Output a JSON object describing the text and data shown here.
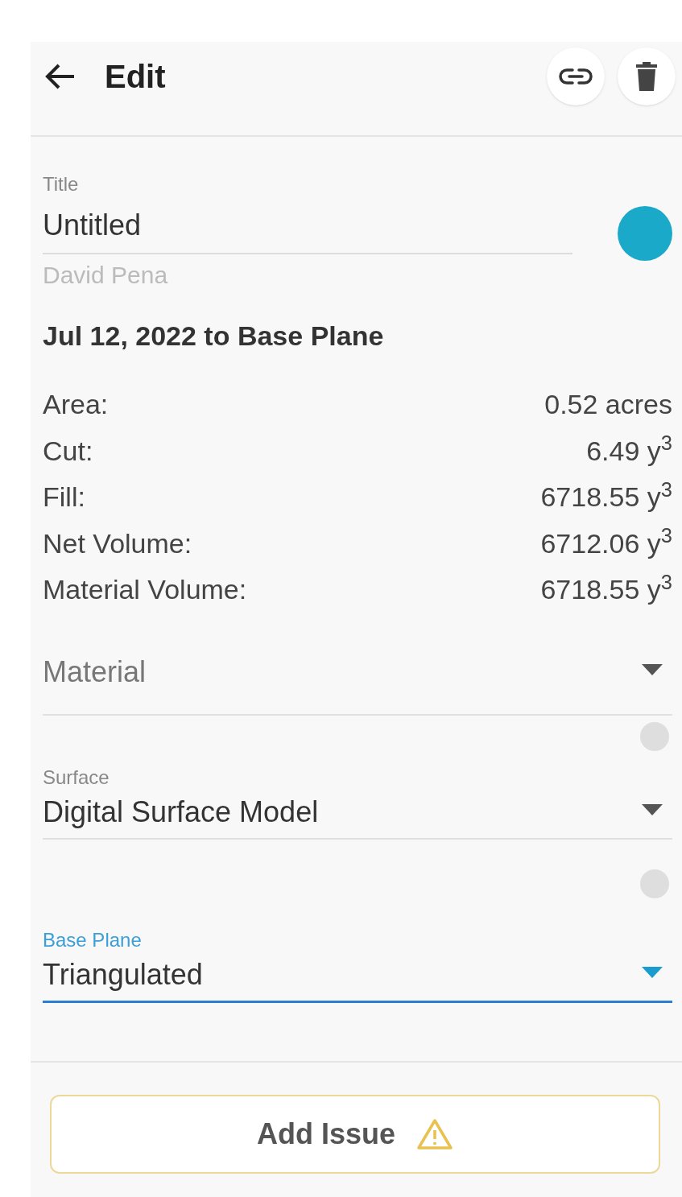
{
  "header": {
    "title": "Edit"
  },
  "title_field": {
    "label": "Title",
    "value": "Untitled",
    "color": "#1aa9c9"
  },
  "author": "David Pena",
  "heading": "Jul 12, 2022 to Base Plane",
  "stats": [
    {
      "label": "Area:",
      "value": "0.52 acres"
    },
    {
      "label": "Cut:",
      "value": "6.49 y$^{3}$"
    },
    {
      "label": "Fill:",
      "value": "6718.55 y$^{3}$"
    },
    {
      "label": "Net Volume:",
      "value": "6712.06 y$^{3}$"
    },
    {
      "label": "Material Volume:",
      "value": "6718.55 y$^{3}$"
    }
  ],
  "selects": [
    {
      "kind": "placeholder",
      "placeholder": "Material",
      "focused": false,
      "help": false
    },
    {
      "kind": "value",
      "label": "Surface",
      "value": "Digital Surface Model",
      "focused": false,
      "help": true
    },
    {
      "kind": "value",
      "label": "Base Plane",
      "value": "Triangulated",
      "focused": true,
      "help": true
    }
  ],
  "add_issue_button": {
    "label": "Add Issue"
  }
}
